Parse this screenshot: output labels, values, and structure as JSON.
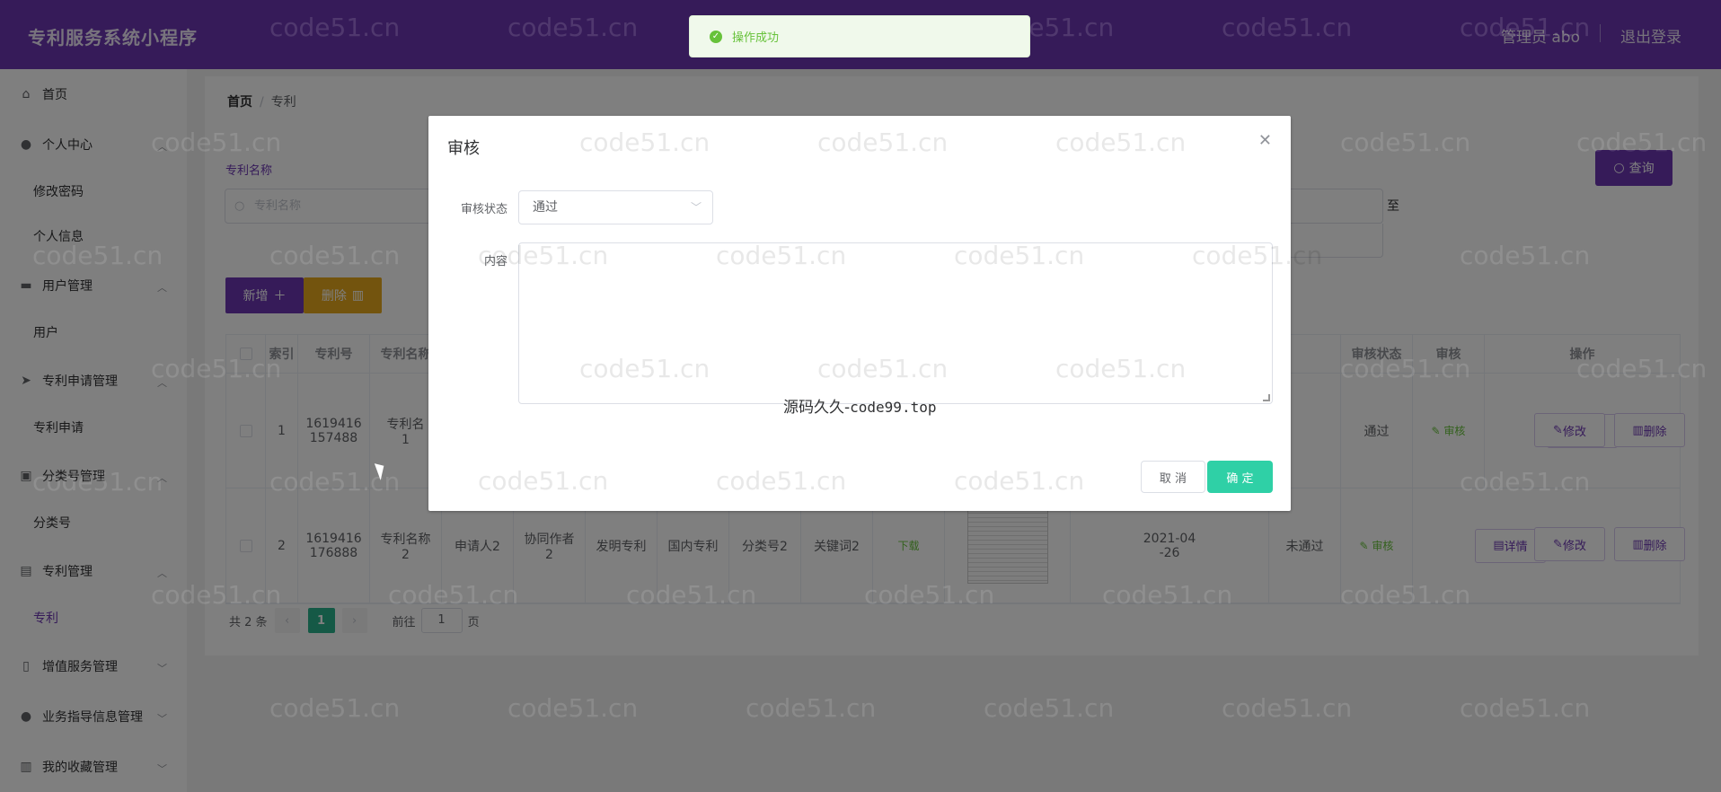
{
  "header": {
    "title": "专利服务系统小程序",
    "user": "管理员 abo",
    "logout": "退出登录"
  },
  "sidebar": {
    "items": [
      {
        "label": "首页"
      },
      {
        "label": "个人中心"
      },
      {
        "label": "修改密码"
      },
      {
        "label": "个人信息"
      },
      {
        "label": "用户管理"
      },
      {
        "label": "用户"
      },
      {
        "label": "专利申请管理"
      },
      {
        "label": "专利申请"
      },
      {
        "label": "分类号管理"
      },
      {
        "label": "分类号"
      },
      {
        "label": "专利管理"
      },
      {
        "label": "专利"
      },
      {
        "label": "增值服务管理"
      },
      {
        "label": "业务指导信息管理"
      },
      {
        "label": "我的收藏管理"
      }
    ]
  },
  "breadcrumb": {
    "home": "首页",
    "sep": "/",
    "current": "专利"
  },
  "filter": {
    "label": "专利名称",
    "placeholder": "专利名称",
    "to": "至",
    "query": "查询"
  },
  "actions": {
    "add": "新增",
    "delete": "删除"
  },
  "table": {
    "headers": [
      "索引",
      "专利号",
      "专利名称",
      "审核状态",
      "审核",
      "操作"
    ],
    "rows": [
      {
        "index": "1",
        "number_a": "1619416",
        "number_b": "157488",
        "name_a": "专利名",
        "name_b": "1",
        "status": "通过",
        "audit": "审核",
        "detail": "详情",
        "edit": "修改",
        "del": "删除"
      },
      {
        "index": "2",
        "number_a": "1619416",
        "number_b": "176888",
        "name_a": "专利名称",
        "name_b": "2",
        "applicant": "申请人2",
        "coauthor_a": "协同作者",
        "coauthor_b": "2",
        "type": "发明专利",
        "region": "国内专利",
        "category": "分类号2",
        "keyword": "关键词2",
        "download": "下载",
        "date_a": "2021-04",
        "date_b": "-26",
        "status": "未通过",
        "audit": "审核",
        "detail": "详情",
        "edit": "修改",
        "del": "删除"
      }
    ]
  },
  "pager": {
    "total": "共 2 条",
    "page": "1",
    "goto": "前往",
    "goto_value": "1",
    "unit": "页"
  },
  "toast": {
    "text": "操作成功"
  },
  "dialog": {
    "title": "审核",
    "status_label": "审核状态",
    "status_value": "通过",
    "content_label": "内容",
    "center_text_cn": "源码久久-",
    "center_text_mono": "code99.top",
    "cancel": "取 消",
    "ok": "确 定"
  },
  "watermark": "code51.cn"
}
